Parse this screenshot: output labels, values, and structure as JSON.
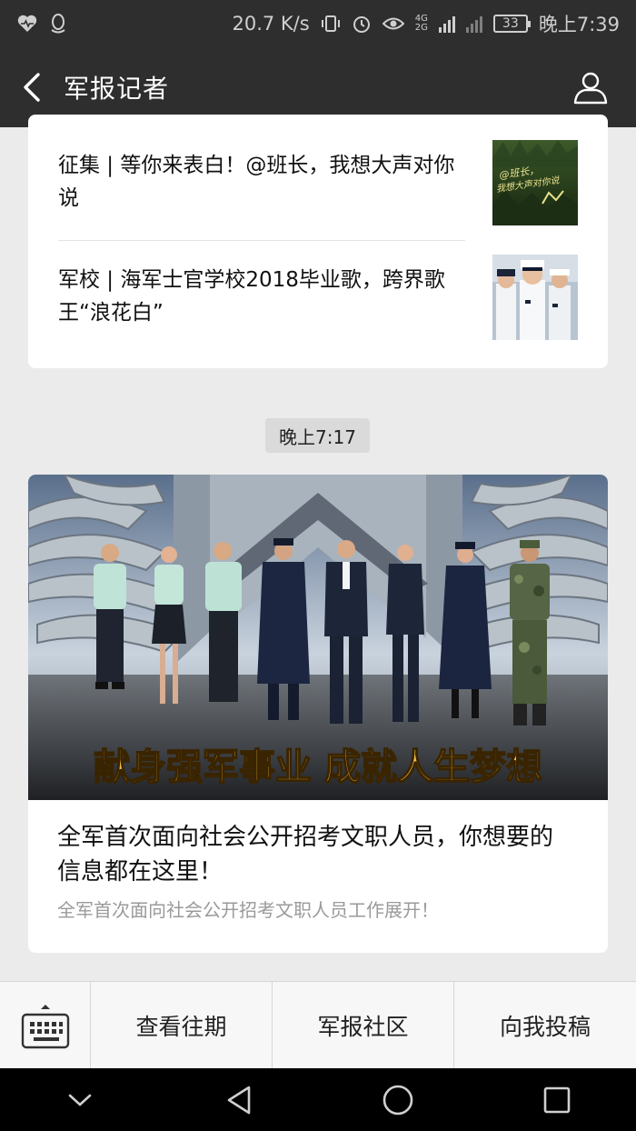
{
  "status_bar": {
    "network_speed": "20.7 K/s",
    "network_type_top": "4G",
    "network_type_bottom": "2G",
    "battery": "33",
    "time": "晚上7:39"
  },
  "header": {
    "title": "军报记者"
  },
  "list_card": {
    "items": [
      {
        "title": "征集 | 等你来表白！@班长，我想大声对你说",
        "thumb_text_1": "@班长，",
        "thumb_text_2": "我想大声对你说"
      },
      {
        "title": "军校 | 海军士官学校2018毕业歌，跨界歌王“浪花白”"
      }
    ]
  },
  "timestamp": "晚上7:17",
  "feature_card": {
    "cover_caption": "献身强军事业 成就人生梦想",
    "title": "全军首次面向社会公开招考文职人员，你想要的信息都在这里！",
    "summary": "全军首次面向社会公开招考文职人员工作展开！"
  },
  "bottom_menu": {
    "items": [
      "查看往期",
      "军报社区",
      "向我投稿"
    ]
  },
  "colors": {
    "title_bar": "#2e2e2e",
    "background": "#ebebeb",
    "cover_caption": "#f2c14a"
  }
}
